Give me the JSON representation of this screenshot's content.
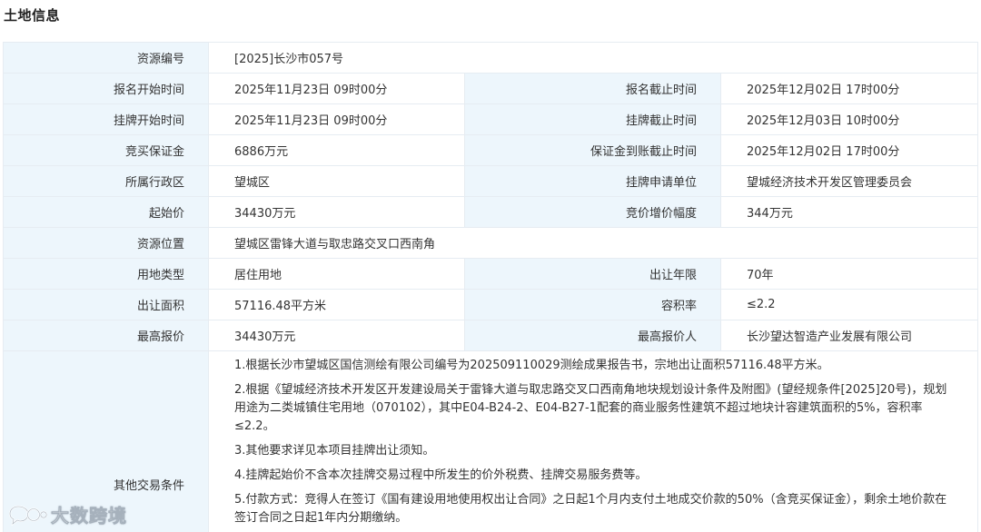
{
  "section_title": "土地信息",
  "rows": {
    "resource_no": {
      "label": "资源编号",
      "value": "[2025]长沙市057号"
    },
    "signup_start": {
      "label": "报名开始时间",
      "value": "2025年11月23日 09时00分"
    },
    "signup_end": {
      "label": "报名截止时间",
      "value": "2025年12月02日 17时00分"
    },
    "listing_start": {
      "label": "挂牌开始时间",
      "value": "2025年11月23日 09时00分"
    },
    "listing_end": {
      "label": "挂牌截止时间",
      "value": "2025年12月03日 10时00分"
    },
    "deposit": {
      "label": "竞买保证金",
      "value": "6886万元"
    },
    "deposit_deadline": {
      "label": "保证金到账截止时间",
      "value": "2025年12月02日 17时00分"
    },
    "district": {
      "label": "所属行政区",
      "value": "望城区"
    },
    "applicant": {
      "label": "挂牌申请单位",
      "value": "望城经济技术开发区管理委员会"
    },
    "start_price": {
      "label": "起始价",
      "value": "34430万元"
    },
    "increment": {
      "label": "竞价增价幅度",
      "value": "344万元"
    },
    "location": {
      "label": "资源位置",
      "value": "望城区雷锋大道与取忠路交叉口西南角"
    },
    "land_use": {
      "label": "用地类型",
      "value": "居住用地"
    },
    "term": {
      "label": "出让年限",
      "value": "70年"
    },
    "area": {
      "label": "出让面积",
      "value": "57116.48平方米"
    },
    "far": {
      "label": "容积率",
      "value": "≤2.2"
    },
    "highest_price": {
      "label": "最高报价",
      "value": "34430万元"
    },
    "highest_bidder": {
      "label": "最高报价人",
      "value": "长沙望达智造产业发展有限公司"
    }
  },
  "other_conditions": {
    "label": "其他交易条件",
    "items": [
      "1.根据长沙市望城区国信测绘有限公司编号为202509110029测绘成果报告书，宗地出让面积57116.48平方米。",
      "2.根据《望城经济技术开发区开发建设局关于雷锋大道与取忠路交叉口西南角地块规划设计条件及附图》(望经规条件[2025]20号)，规划用途为二类城镇住宅用地（070102），其中E04-B24-2、E04-B27-1配套的商业服务性建筑不超过地块计容建筑面积的5%，容积率≤2.2。",
      "3.其他要求详见本项目挂牌出让须知。",
      "4.挂牌起始价不含本次挂牌交易过程中所发生的价外税费、挂牌交易服务费等。",
      "5.付款方式：竞得人在签订《国有建设用地使用权出让合同》之日起1个月内支付土地成交价款的50%（含竞买保证金），剩余土地价款在签订合同之日起1年内分期缴纳。"
    ]
  },
  "watermark": {
    "text": "大数跨境",
    "icon": "chat-bubble-logo-icon"
  }
}
